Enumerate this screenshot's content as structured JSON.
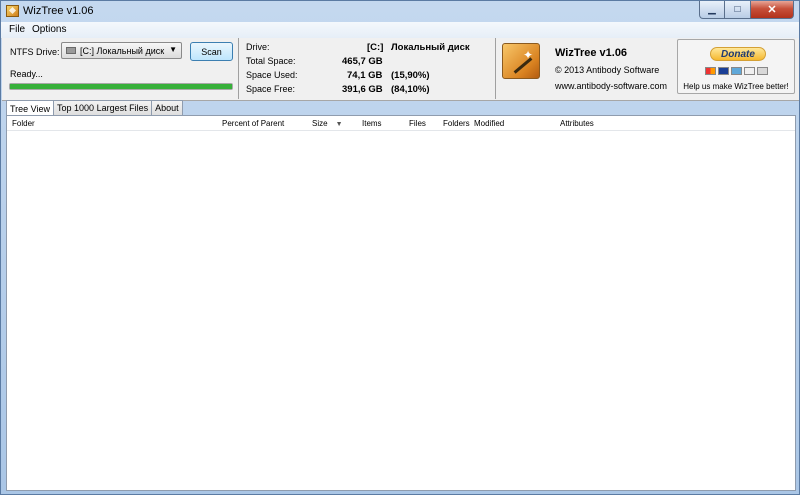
{
  "window": {
    "title": "WizTree v1.06"
  },
  "menu": [
    "File",
    "Options"
  ],
  "scan_panel": {
    "ntfs_label": "NTFS Drive:",
    "selected_drive": "[C:] Локальный диск",
    "scan_label": "Scan",
    "status": "Ready...",
    "progress": 1.0
  },
  "drive_info": {
    "rows": [
      {
        "label": "Drive:",
        "value": "[C:]",
        "extra": "Локальный диск"
      },
      {
        "label": "Total Space:",
        "value": "465,7 GB",
        "extra": ""
      },
      {
        "label": "Space Used:",
        "value": "74,1 GB",
        "extra": "(15,90%)"
      },
      {
        "label": "Space Free:",
        "value": "391,6 GB",
        "extra": "(84,10%)"
      }
    ]
  },
  "brand": {
    "title": "WizTree v1.06",
    "copyright": "© 2013 Antibody Software",
    "website": "www.antibody-software.com"
  },
  "donate": {
    "button_label": "Donate",
    "message": "Help us make WizTree better!",
    "cards": [
      "mastercard-icon",
      "visa-icon",
      "amex-icon",
      "discover-icon",
      "bank-icon"
    ]
  },
  "tabs": [
    {
      "label": "Tree View",
      "active": true
    },
    {
      "label": "Top 1000 Largest Files",
      "active": false
    },
    {
      "label": "About",
      "active": false
    }
  ],
  "tree": {
    "columns": [
      "Folder",
      "Percent of Parent",
      "Size",
      "Items",
      "Files",
      "Folders",
      "Modified",
      "Attributes"
    ],
    "rows": []
  },
  "colors": {
    "progress": "#37b03a",
    "title_bar": "#c4d8ef"
  }
}
